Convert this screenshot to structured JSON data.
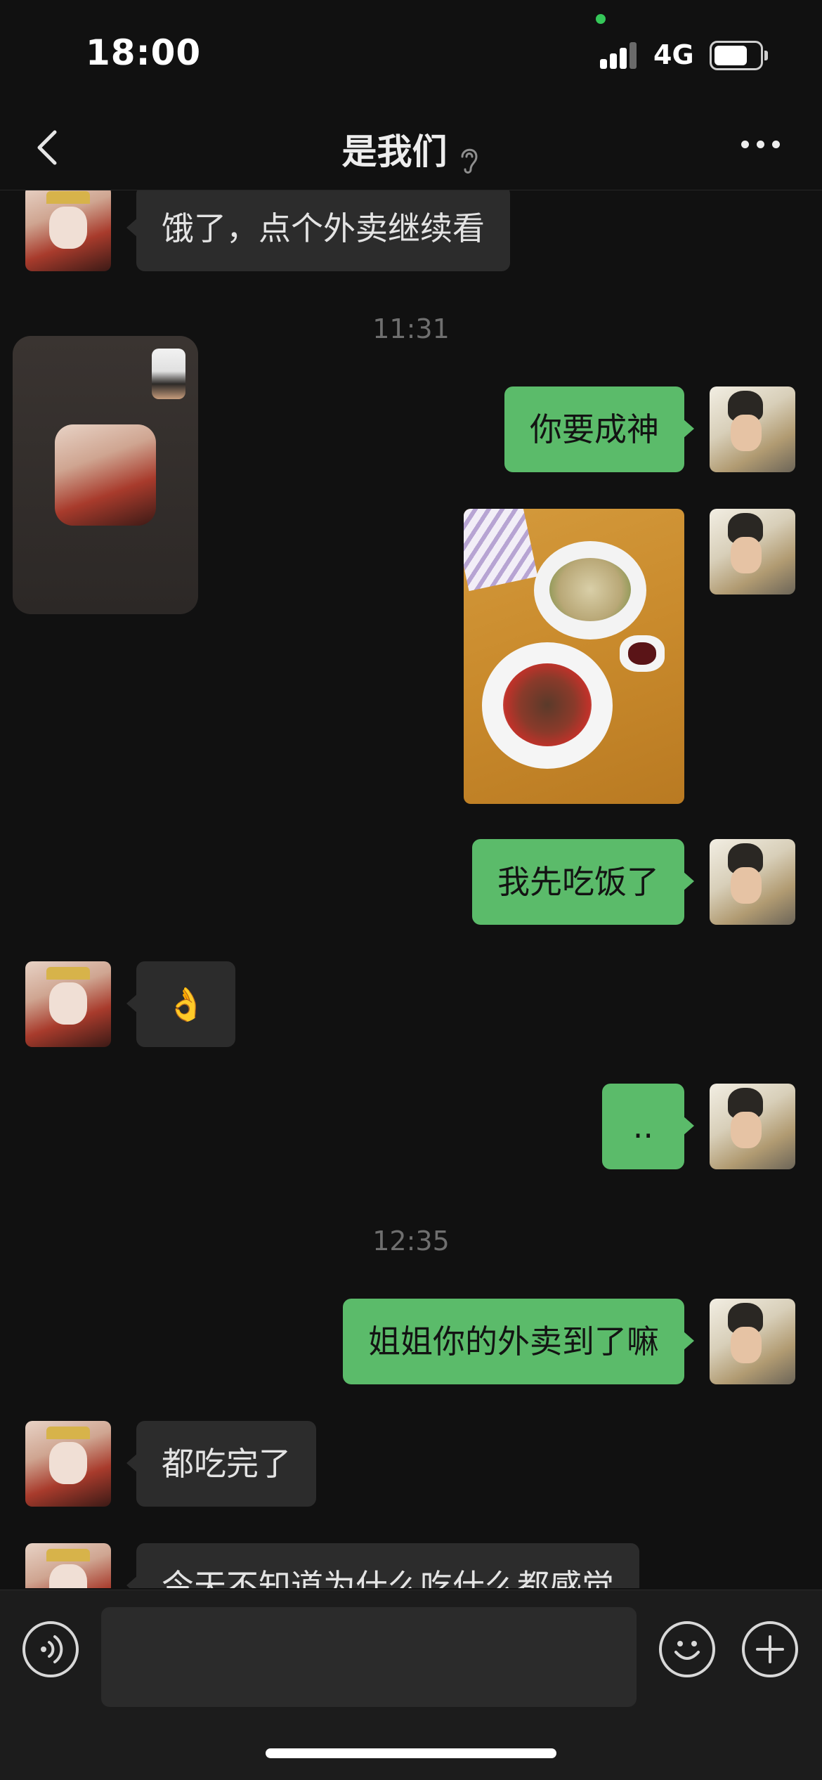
{
  "status_bar": {
    "time": "18:00",
    "network": "4G"
  },
  "nav": {
    "title": "是我们"
  },
  "messages": {
    "m1": "饿了，点个外卖继续看",
    "ts1": "11:31",
    "m2": "你要成神",
    "m4": "我先吃饭了",
    "m5": "👌",
    "m6": "..",
    "ts2": "12:35",
    "m7": "姐姐你的外卖到了嘛",
    "m8": "都吃完了",
    "m9": "今天不知道为什么吃什么都感觉"
  },
  "colors": {
    "outgoing_bubble": "#5bbb6a",
    "incoming_bubble": "#2c2c2c",
    "background": "#111111"
  }
}
